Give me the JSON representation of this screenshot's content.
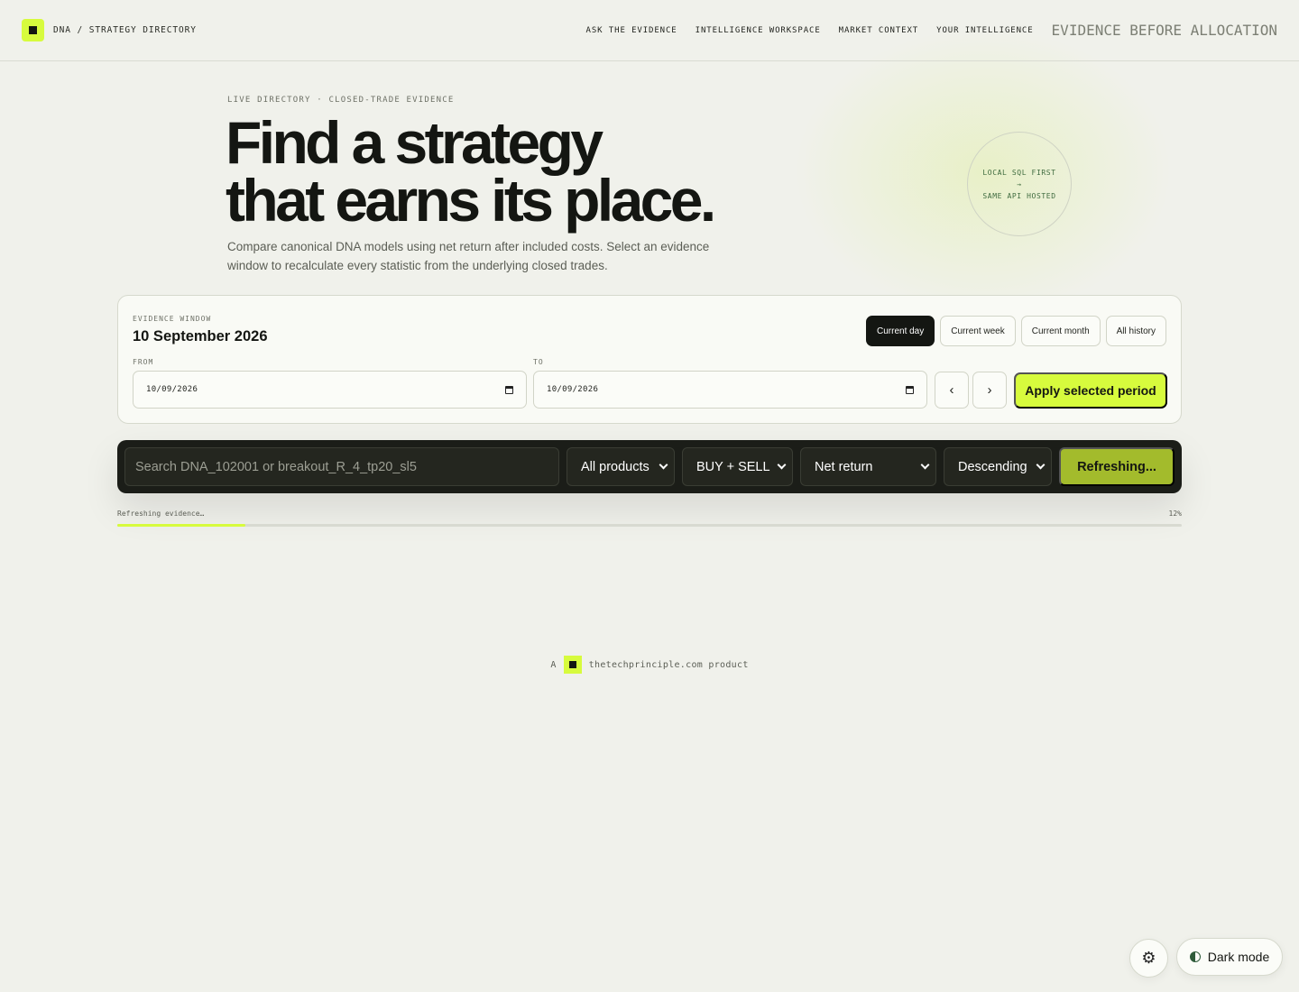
{
  "header": {
    "brand": "DNA / STRATEGY DIRECTORY",
    "nav": [
      "ASK THE EVIDENCE",
      "INTELLIGENCE WORKSPACE",
      "MARKET CONTEXT",
      "YOUR INTELLIGENCE"
    ],
    "tagline": "EVIDENCE BEFORE ALLOCATION"
  },
  "hero": {
    "eyebrow": "LIVE DIRECTORY · CLOSED-TRADE EVIDENCE",
    "title_line1": "Find a strategy",
    "title_line2": "that earns its place.",
    "description": "Compare canonical DNA models using net return after included costs. Select an evidence window to recalculate every statistic from the underlying closed trades.",
    "badge_line1": "LOCAL SQL FIRST",
    "badge_arrow": "→",
    "badge_line2": "SAME API HOSTED"
  },
  "evidence_window": {
    "label": "EVIDENCE WINDOW",
    "value": "10 September 2026",
    "periods": [
      "Current day",
      "Current week",
      "Current month",
      "All history"
    ],
    "active_period": "Current day",
    "from_label": "FROM",
    "from_value": "10/09/2026",
    "to_label": "TO",
    "to_value": "10/09/2026",
    "prev": "‹",
    "next": "›",
    "apply_label": "Apply selected period"
  },
  "filters": {
    "search_placeholder": "Search DNA_102001 or breakout_R_4_tp20_sl5",
    "product": "All products",
    "side": "BUY + SELL",
    "metric": "Net return",
    "order": "Descending",
    "refresh_label": "Refreshing..."
  },
  "progress": {
    "label": "Refreshing evidence…",
    "percent_text": "12%",
    "fraction": 0.12
  },
  "footer": {
    "prefix": "A",
    "suffix": "thetechprinciple.com product"
  },
  "controls": {
    "dark_mode_label": "Dark mode"
  },
  "colors": {
    "accent": "#d7fb3d",
    "background": "#f0f1eb",
    "dark": "#141612"
  }
}
